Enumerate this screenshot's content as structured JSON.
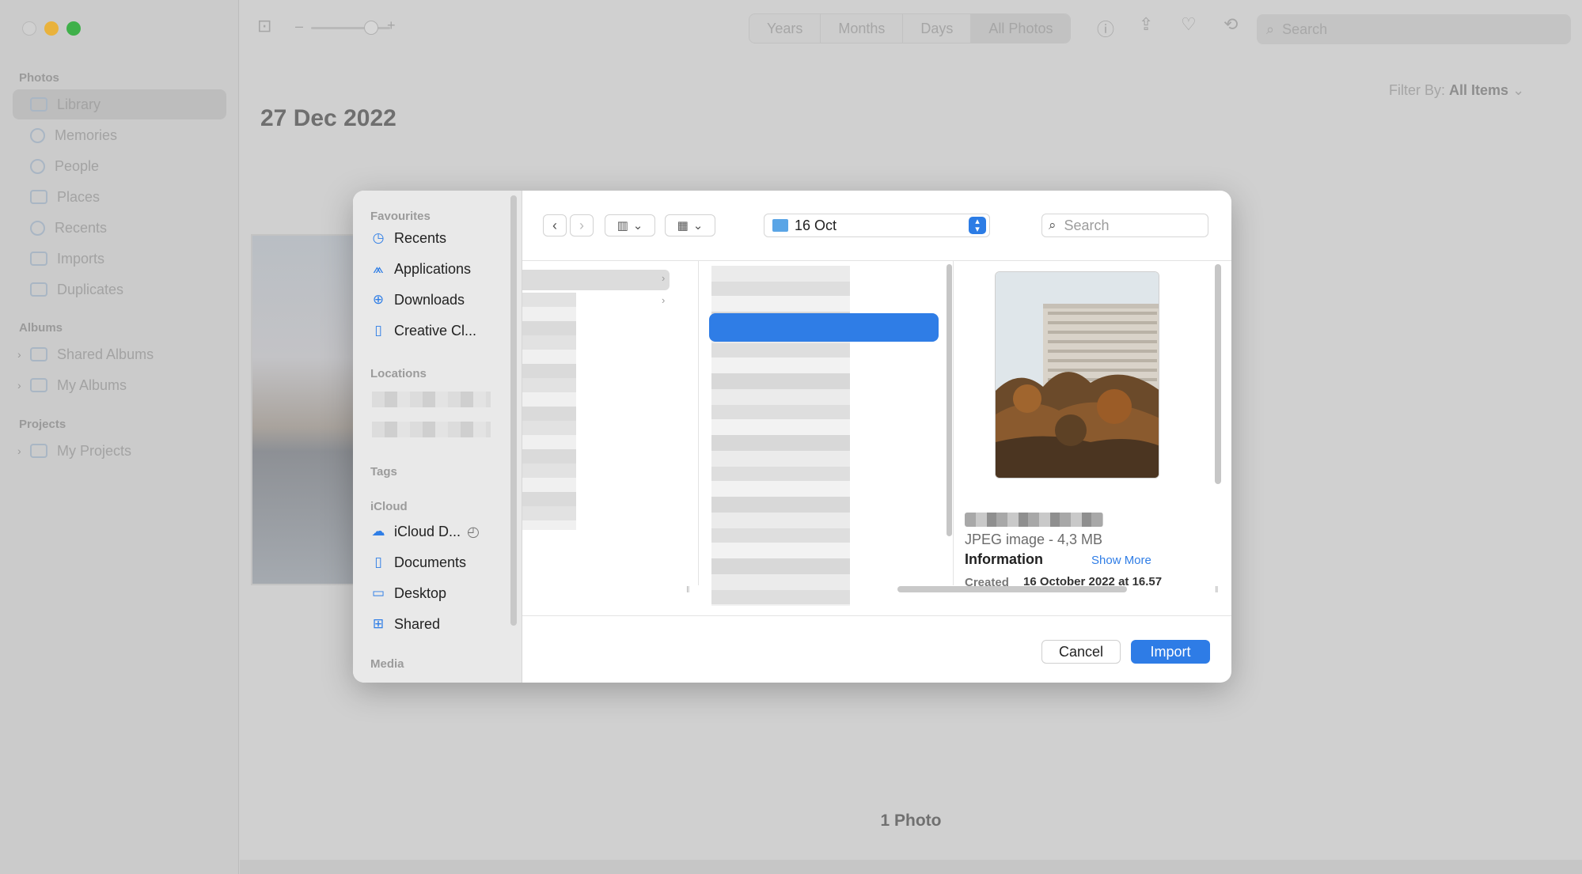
{
  "photos_sidebar": {
    "sections": [
      {
        "label": "Photos"
      },
      {
        "label": "Albums"
      },
      {
        "label": "Projects"
      }
    ],
    "items": [
      {
        "label": "Library"
      },
      {
        "label": "Memories"
      },
      {
        "label": "People"
      },
      {
        "label": "Places"
      },
      {
        "label": "Recents"
      },
      {
        "label": "Imports"
      },
      {
        "label": "Duplicates"
      },
      {
        "label": "Shared Albums"
      },
      {
        "label": "My Albums"
      },
      {
        "label": "My Projects"
      }
    ]
  },
  "toolbar": {
    "zoom_minus": "–",
    "zoom_plus": "+",
    "segments": [
      "Years",
      "Months",
      "Days",
      "All Photos"
    ],
    "search_placeholder": "Search"
  },
  "main": {
    "date_title": "27 Dec 2022",
    "filter_label": "Filter By:",
    "filter_value": "All Items",
    "photo_count": "1 Photo"
  },
  "dialog": {
    "sidebar": {
      "favourites_label": "Favourites",
      "favourites": [
        {
          "label": "Recents",
          "icon": "clock-icon"
        },
        {
          "label": "Applications",
          "icon": "applications-icon"
        },
        {
          "label": "Downloads",
          "icon": "download-icon"
        },
        {
          "label": "Creative Cl...",
          "icon": "document-icon"
        }
      ],
      "locations_label": "Locations",
      "tags_label": "Tags",
      "icloud_label": "iCloud",
      "icloud_items": [
        {
          "label": "iCloud D...",
          "icon": "cloud-icon"
        },
        {
          "label": "Documents",
          "icon": "document-icon"
        },
        {
          "label": "Desktop",
          "icon": "desktop-icon"
        },
        {
          "label": "Shared",
          "icon": "shared-folder-icon"
        }
      ],
      "media_label": "Media"
    },
    "location": "16 Oct",
    "search_placeholder": "Search",
    "preview": {
      "file_type": "JPEG image - 4,3 MB",
      "info_heading": "Information",
      "show_more": "Show More",
      "created_label": "Created",
      "created_value": "16 October 2022 at 16.57"
    },
    "buttons": {
      "cancel": "Cancel",
      "import": "Import"
    }
  },
  "colors": {
    "accent": "#2e7ce6",
    "traffic_min": "#e9b23c",
    "traffic_max": "#3fb04a"
  }
}
